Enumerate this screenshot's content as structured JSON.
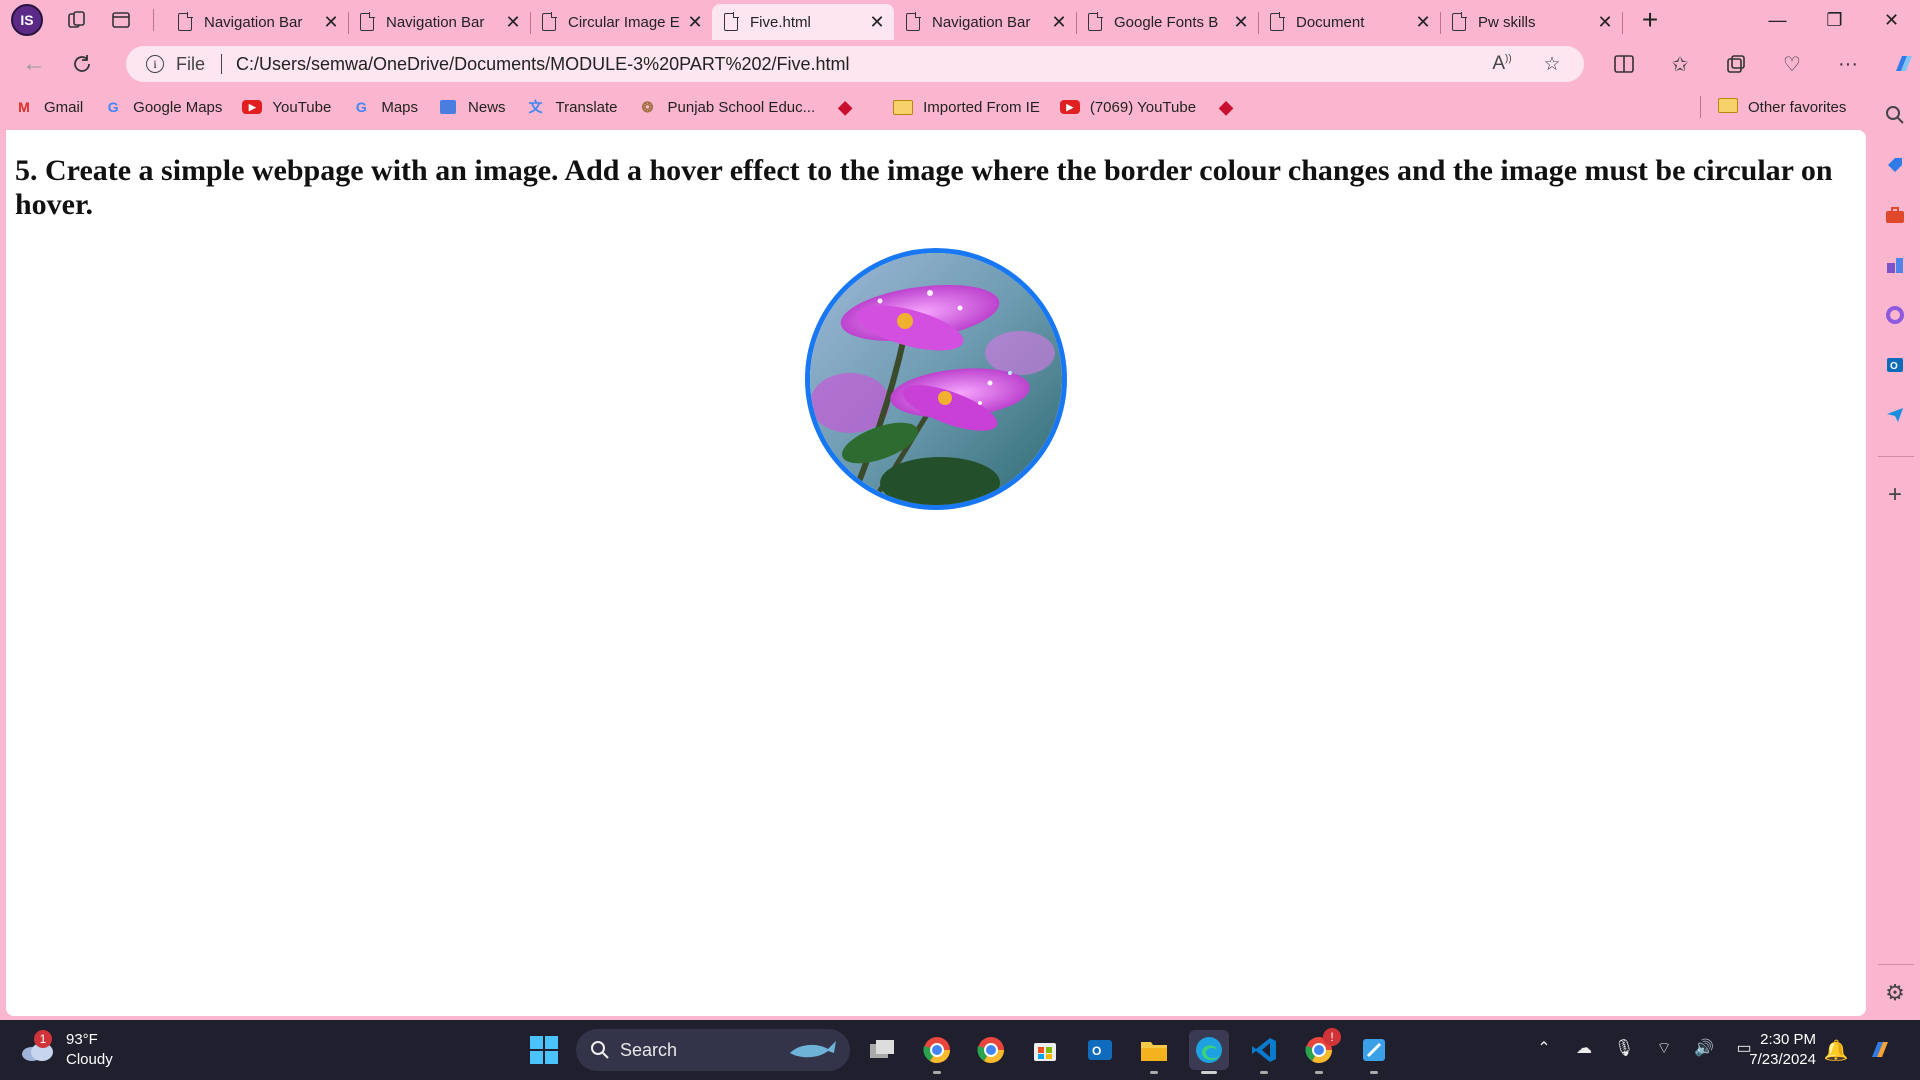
{
  "browser": {
    "profile_initials": "IS",
    "tabs": [
      {
        "label": "Navigation Bar",
        "active": false
      },
      {
        "label": "Navigation Bar",
        "active": false
      },
      {
        "label": "Circular Image E",
        "active": false
      },
      {
        "label": "Five.html",
        "active": true
      },
      {
        "label": "Navigation Bar",
        "active": false
      },
      {
        "label": "Google Fonts B",
        "active": false
      },
      {
        "label": "Document",
        "active": false
      },
      {
        "label": "Pw skills",
        "active": false
      }
    ],
    "address": {
      "scheme_label": "File",
      "url": "C:/Users/semwa/OneDrive/Documents/MODULE-3%20PART%202/Five.html"
    },
    "favorites": [
      {
        "label": "Gmail",
        "icon": "gmail-icon"
      },
      {
        "label": "Google Maps",
        "icon": "google-icon"
      },
      {
        "label": "YouTube",
        "icon": "youtube-icon"
      },
      {
        "label": "Maps",
        "icon": "google-icon"
      },
      {
        "label": "News",
        "icon": "news-icon"
      },
      {
        "label": "Translate",
        "icon": "translate-icon"
      },
      {
        "label": "Punjab School Educ...",
        "icon": "emblem-icon"
      },
      {
        "label": "",
        "icon": "diamond-icon"
      },
      {
        "label": "Imported From IE",
        "icon": "folder-icon"
      },
      {
        "label": "(7069) YouTube",
        "icon": "youtube-icon"
      },
      {
        "label": "",
        "icon": "diamond-icon"
      }
    ],
    "other_favorites": "Other favorites"
  },
  "page": {
    "heading": "5. Create a simple webpage with an image. Add a hover effect to the image where the border colour changes and the image must be circular on hover.",
    "image_border_color": "#1877f2"
  },
  "taskbar": {
    "weather_temp": "93°F",
    "weather_desc": "Cloudy",
    "weather_badge": "1",
    "search_label": "Search",
    "chrome_badge": "!",
    "time": "2:30 PM",
    "date": "7/23/2024"
  },
  "colors": {
    "chrome_pink": "#fbb6cf",
    "active_tab": "#fde6ef",
    "taskbar": "#1f1f2e"
  }
}
